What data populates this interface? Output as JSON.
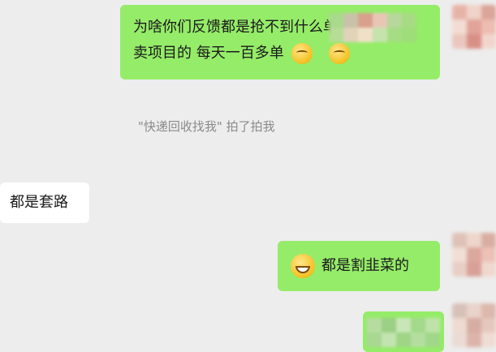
{
  "messages": {
    "msg1": {
      "line1": "为啥你们反馈都是抢不到什么单子 那些",
      "line2": "卖项目的 每天一百多单"
    },
    "notice": "\"快递回收找我\" 拍了拍我",
    "msg2": "都是套路",
    "msg3": "都是割韭菜的"
  },
  "colors": {
    "outgoing_bubble": "#95ec69",
    "incoming_bubble": "#ffffff",
    "background": "#ededed"
  },
  "icons": {
    "msg1_emoji": "smirk-emoji-icon",
    "msg3_emoji": "grin-emoji-icon"
  }
}
